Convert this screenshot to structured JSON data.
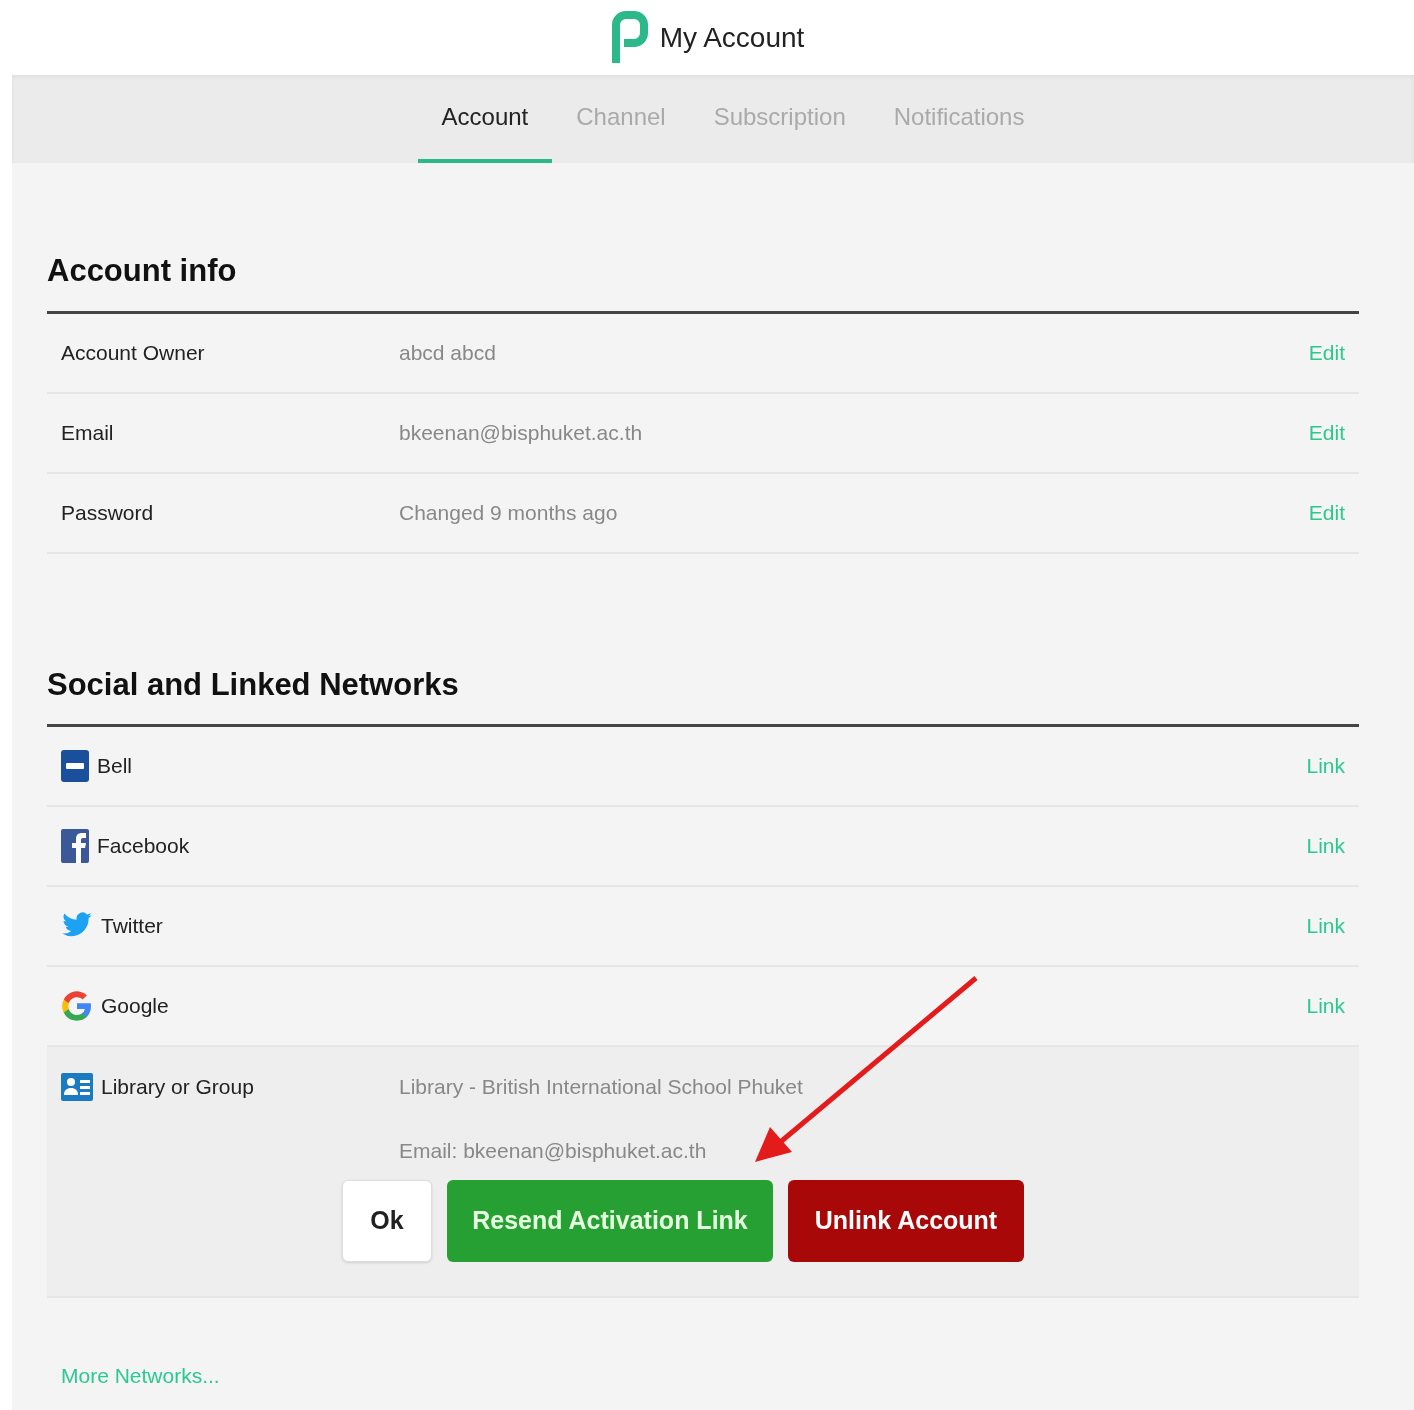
{
  "header": {
    "title": "My Account"
  },
  "tabs": [
    {
      "label": "Account",
      "selected": true
    },
    {
      "label": "Channel",
      "selected": false
    },
    {
      "label": "Subscription",
      "selected": false
    },
    {
      "label": "Notifications",
      "selected": false
    }
  ],
  "account_info": {
    "title": "Account info",
    "rows": [
      {
        "label": "Account Owner",
        "value": "abcd abcd",
        "action": "Edit"
      },
      {
        "label": "Email",
        "value": "bkeenan@bisphuket.ac.th",
        "action": "Edit"
      },
      {
        "label": "Password",
        "value": "Changed 9 months ago",
        "action": "Edit"
      }
    ]
  },
  "networks": {
    "title": "Social and Linked Networks",
    "items": [
      {
        "kind": "bell",
        "name": "Bell",
        "action": "Link"
      },
      {
        "kind": "facebook",
        "name": "Facebook",
        "action": "Link"
      },
      {
        "kind": "twitter",
        "name": "Twitter",
        "action": "Link"
      },
      {
        "kind": "google",
        "name": "Google",
        "action": "Link"
      },
      {
        "kind": "group",
        "name": "Library or Group",
        "details": [
          "Library - British International School Phuket",
          "Email: bkeenan@bisphuket.ac.th"
        ],
        "buttons": [
          {
            "kind": "plain",
            "label": "Ok"
          },
          {
            "kind": "confirm",
            "label": "Resend Activation Link"
          },
          {
            "kind": "danger",
            "label": "Unlink Account"
          }
        ]
      }
    ],
    "more_link": "More Networks..."
  }
}
